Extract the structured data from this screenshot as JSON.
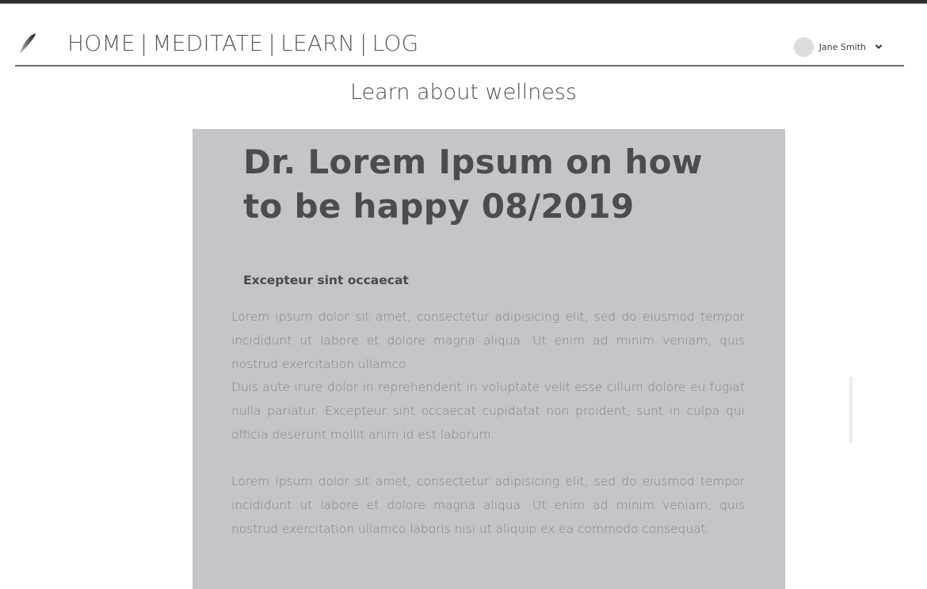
{
  "nav": {
    "home": "HOME",
    "meditate": "MEDITATE",
    "learn": "LEARN",
    "log": "LOG",
    "separator": "|"
  },
  "user": {
    "name": "Jane Smith"
  },
  "page": {
    "title": "Learn about wellness"
  },
  "article": {
    "title": "Dr. Lorem Ipsum on how to be happy 08/2019",
    "subheading": "Excepteur sint occaecat",
    "paragraphs": [
      "Lorem ipsum dolor sit amet, consectetur adipisicing elit, sed do eiusmod tempor incididunt ut labore et dolore magna aliqua. Ut enim ad minim veniam, quis nostrud exercitation ullamco",
      "Duis aute irure dolor in reprehenderit in voluptate velit esse cillum dolore eu fugiat nulla pariatur. Excepteur sint occaecat cupidatat non proident, sunt in culpa qui officia deserunt mollit anim id est laborum.",
      "Lorem ipsum dolor sit amet, consectetur adipisicing elit, sed do eiusmod tempor incididunt ut labore et dolore magna aliqua. Ut enim ad minim veniam, quis nostrud exercitation ullamco laboris nisi ut aliquip ex ea commodo consequat."
    ]
  },
  "icons": {
    "logo": "feather-logo-icon",
    "user_menu": "chevron-down-icon"
  },
  "colors": {
    "article_background": "#c4c5c9",
    "header_rule": "#6b6b6b"
  }
}
